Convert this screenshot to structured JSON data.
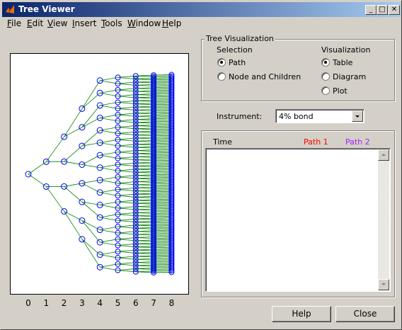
{
  "window": {
    "title": "Tree Viewer"
  },
  "title_buttons": {
    "minimize": "_",
    "maximize": "□",
    "close": "✕"
  },
  "menu": [
    {
      "label": "File",
      "underline": "F",
      "rest": "ile"
    },
    {
      "label": "Edit",
      "underline": "E",
      "rest": "dit"
    },
    {
      "label": "View",
      "underline": "V",
      "rest": "iew"
    },
    {
      "label": "Insert",
      "underline": "I",
      "rest": "nsert"
    },
    {
      "label": "Tools",
      "underline": "T",
      "rest": "ools"
    },
    {
      "label": "Window",
      "underline": "W",
      "rest": "indow"
    },
    {
      "label": "Help",
      "underline": "H",
      "rest": "elp"
    }
  ],
  "tree_visualization": {
    "title": "Tree Visualization",
    "selection_label": "Selection",
    "selection_options": [
      {
        "label": "Path",
        "checked": true
      },
      {
        "label": "Node and Children",
        "checked": false
      }
    ],
    "visualization_label": "Visualization",
    "visualization_options": [
      {
        "label": "Table",
        "checked": true
      },
      {
        "label": "Diagram",
        "checked": false
      },
      {
        "label": "Plot",
        "checked": false
      }
    ]
  },
  "instrument": {
    "label": "Instrument:",
    "value": "4% bond"
  },
  "table": {
    "headers": [
      "Time",
      "Path 1",
      "Path 2"
    ],
    "header_colors": [
      "#000000",
      "#ff0000",
      "#a020f0"
    ]
  },
  "buttons": {
    "help": "Help",
    "close": "Close"
  },
  "tree_plot": {
    "x_ticks": [
      "0",
      "1",
      "2",
      "3",
      "4",
      "5",
      "6",
      "7",
      "8"
    ],
    "node_color": "#0000ff",
    "edge_color": "#007f00",
    "levels": 8
  }
}
